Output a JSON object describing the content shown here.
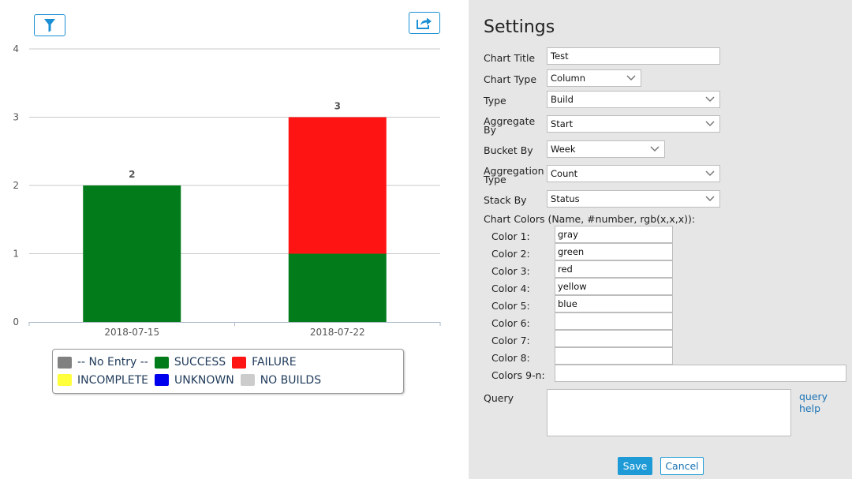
{
  "toolbar": {
    "filter_icon": "filter-icon",
    "export_icon": "share-export-icon"
  },
  "chart_data": {
    "type": "bar",
    "stacked": true,
    "categories": [
      "2018-07-15",
      "2018-07-22"
    ],
    "series": [
      {
        "name": "-- No Entry --",
        "color": "#808080",
        "values": [
          0,
          0
        ]
      },
      {
        "name": "SUCCESS",
        "color": "#027c1a",
        "values": [
          2,
          1
        ]
      },
      {
        "name": "FAILURE",
        "color": "#ff1414",
        "values": [
          0,
          2
        ]
      },
      {
        "name": "INCOMPLETE",
        "color": "#ffff3c",
        "values": [
          0,
          0
        ]
      },
      {
        "name": "UNKNOWN",
        "color": "#0000ee",
        "values": [
          0,
          0
        ]
      },
      {
        "name": "NO BUILDS",
        "color": "#cccccc",
        "values": [
          0,
          0
        ]
      }
    ],
    "totals": [
      "2",
      "3"
    ],
    "ylim": [
      0,
      4
    ],
    "yticks": [
      "0",
      "1",
      "2",
      "3",
      "4"
    ],
    "grid": true,
    "legend_position": "bottom",
    "title": "",
    "xlabel": "",
    "ylabel": ""
  },
  "settings": {
    "title": "Settings",
    "fields": {
      "chart_title": {
        "label": "Chart Title",
        "value": "Test"
      },
      "chart_type": {
        "label": "Chart Type",
        "value": "Column"
      },
      "type": {
        "label": "Type",
        "value": "Build"
      },
      "aggregate_by": {
        "label_line1": "Aggregate",
        "label_line2": "By",
        "value": "Start"
      },
      "bucket_by": {
        "label": "Bucket By",
        "value": "Week"
      },
      "aggregation_type": {
        "label_line1": "Aggregation",
        "label_line2": "Type",
        "value": "Count"
      },
      "stack_by": {
        "label": "Stack By",
        "value": "Status"
      }
    },
    "colors_heading": "Chart Colors (Name, #number, rgb(x,x,x)):",
    "colors": [
      {
        "label": "Color 1:",
        "value": "gray"
      },
      {
        "label": "Color 2:",
        "value": "green"
      },
      {
        "label": "Color 3:",
        "value": "red"
      },
      {
        "label": "Color 4:",
        "value": "yellow"
      },
      {
        "label": "Color 5:",
        "value": "blue"
      },
      {
        "label": "Color 6:",
        "value": ""
      },
      {
        "label": "Color 7:",
        "value": ""
      },
      {
        "label": "Color 8:",
        "value": ""
      }
    ],
    "colors_rest": {
      "label": "Colors 9-n:",
      "value": ""
    },
    "query": {
      "label": "Query",
      "value": "",
      "help": "query help"
    },
    "save_label": "Save",
    "cancel_label": "Cancel"
  },
  "colors": {
    "accent": "#1e9bd7",
    "panel_bg": "#e6e6e6",
    "link": "#1a73b5"
  }
}
